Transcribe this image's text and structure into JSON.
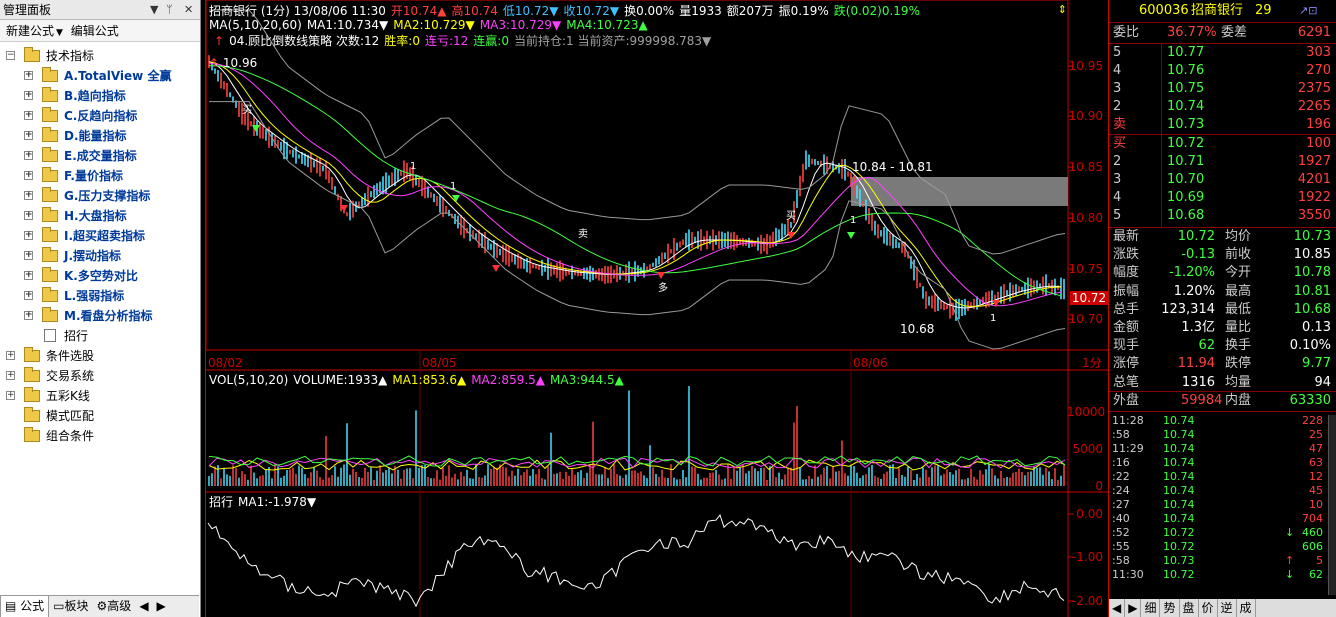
{
  "left_panel": {
    "title": "管理面板",
    "toolbar": {
      "new_formula": "新建公式",
      "edit_formula": "编辑公式"
    },
    "tree": [
      {
        "label": "技术指标",
        "level": 0,
        "type": "folder",
        "expander": "-"
      },
      {
        "label": "A.TotalView 全赢",
        "level": 1,
        "type": "folder",
        "expander": "+"
      },
      {
        "label": "B.趋向指标",
        "level": 1,
        "type": "folder",
        "expander": "+"
      },
      {
        "label": "C.反趋向指标",
        "level": 1,
        "type": "folder",
        "expander": "+"
      },
      {
        "label": "D.能量指标",
        "level": 1,
        "type": "folder",
        "expander": "+"
      },
      {
        "label": "E.成交量指标",
        "level": 1,
        "type": "folder",
        "expander": "+"
      },
      {
        "label": "F.量价指标",
        "level": 1,
        "type": "folder",
        "expander": "+"
      },
      {
        "label": "G.压力支撑指标",
        "level": 1,
        "type": "folder",
        "expander": "+"
      },
      {
        "label": "H.大盘指标",
        "level": 1,
        "type": "folder",
        "expander": "+"
      },
      {
        "label": "I.超买超卖指标",
        "level": 1,
        "type": "folder",
        "expander": "+"
      },
      {
        "label": "J.摆动指标",
        "level": 1,
        "type": "folder",
        "expander": "+"
      },
      {
        "label": "K.多空势对比",
        "level": 1,
        "type": "folder",
        "expander": "+"
      },
      {
        "label": "L.强弱指标",
        "level": 1,
        "type": "folder",
        "expander": "+"
      },
      {
        "label": "M.看盘分析指标",
        "level": 1,
        "type": "folder",
        "expander": "+"
      },
      {
        "label": "招行",
        "level": 1,
        "type": "doc",
        "expander": ""
      },
      {
        "label": "条件选股",
        "level": 0,
        "type": "folder",
        "expander": "+"
      },
      {
        "label": "交易系统",
        "level": 0,
        "type": "folder",
        "expander": "+"
      },
      {
        "label": "五彩K线",
        "level": 0,
        "type": "folder",
        "expander": "+"
      },
      {
        "label": "模式匹配",
        "level": 0,
        "type": "folder",
        "expander": ""
      },
      {
        "label": "组合条件",
        "level": 0,
        "type": "folder",
        "expander": ""
      }
    ],
    "bottom_tabs": [
      "公式",
      "板块",
      "高级"
    ]
  },
  "chart": {
    "header1": [
      {
        "text": "招商银行 (1分)  13/08/06 11:30",
        "color": "#ffffff"
      },
      {
        "text": "开10.74▲",
        "color": "#ff4040"
      },
      {
        "text": "高10.74",
        "color": "#ff4040"
      },
      {
        "text": "低10.72▼",
        "color": "#40c0ff"
      },
      {
        "text": "收10.72▼",
        "color": "#40c0ff"
      },
      {
        "text": "换0.00%",
        "color": "#ffffff"
      },
      {
        "text": "量1933",
        "color": "#ffffff"
      },
      {
        "text": "额207万",
        "color": "#ffffff"
      },
      {
        "text": "振0.19%",
        "color": "#ffffff"
      },
      {
        "text": "跌(0.02)0.19%",
        "color": "#40ff40"
      }
    ],
    "header2": [
      {
        "text": "MA(5,10,20,60)",
        "color": "#ffffff"
      },
      {
        "text": "MA1:10.734▼",
        "color": "#ffffff"
      },
      {
        "text": "MA2:10.729▼",
        "color": "#ffff00"
      },
      {
        "text": "MA3:10.729▼",
        "color": "#ff40ff"
      },
      {
        "text": "MA4:10.723▲",
        "color": "#40ff40"
      }
    ],
    "header3": [
      {
        "text": "↑",
        "color": "#ff3030"
      },
      {
        "text": "04.顾比倒数线策略 次数:12",
        "color": "#ffffff"
      },
      {
        "text": "胜率:0",
        "color": "#ffff00"
      },
      {
        "text": "连亏:12",
        "color": "#ff40ff"
      },
      {
        "text": "连赢:0",
        "color": "#40ff40"
      },
      {
        "text": "当前持仓:1  当前资产:999998.783▼",
        "color": "#a0a0a0"
      }
    ],
    "price_axis": [
      "10.95",
      "10.90",
      "10.85",
      "10.80",
      "10.75",
      "10.70"
    ],
    "current_price_tag": "10.72",
    "annotations": {
      "high": "10.96",
      "low": "10.68",
      "zone": "10.84 - 10.81"
    },
    "date_labels": [
      "08/02",
      "08/05",
      "08/06"
    ],
    "period_label": "1分",
    "volume_header": [
      {
        "text": "VOL(5,10,20)",
        "color": "#ffffff"
      },
      {
        "text": "VOLUME:1933▲",
        "color": "#ffffff"
      },
      {
        "text": "MA1:853.6▲",
        "color": "#ffff00"
      },
      {
        "text": "MA2:859.5▲",
        "color": "#ff40ff"
      },
      {
        "text": "MA3:944.5▲",
        "color": "#40ff40"
      }
    ],
    "volume_axis": [
      "10000",
      "5000",
      "0"
    ],
    "indicator_header": [
      {
        "text": "招行",
        "color": "#ffffff"
      },
      {
        "text": "MA1:-1.978▼",
        "color": "#ffffff"
      }
    ],
    "indicator_axis": [
      "0.00",
      "-1.00",
      "-2.00"
    ],
    "signal_labels": [
      "买",
      "1",
      "1",
      "卖",
      "多"
    ]
  },
  "quote": {
    "code": "600036",
    "name": "招商银行",
    "num": "29",
    "weibi_label": "委比",
    "weibi": "36.77%",
    "weicha_label": "委差",
    "weicha": "6291",
    "asks": [
      {
        "level": "5",
        "price": "10.77",
        "vol": "303"
      },
      {
        "level": "4",
        "price": "10.76",
        "vol": "270"
      },
      {
        "level": "3",
        "price": "10.75",
        "vol": "2375"
      },
      {
        "level": "2",
        "price": "10.74",
        "vol": "2265"
      },
      {
        "level": "卖",
        "price": "10.73",
        "vol": "196"
      }
    ],
    "bids": [
      {
        "level": "买",
        "price": "10.72",
        "vol": "100"
      },
      {
        "level": "2",
        "price": "10.71",
        "vol": "1927"
      },
      {
        "level": "3",
        "price": "10.70",
        "vol": "4201"
      },
      {
        "level": "4",
        "price": "10.69",
        "vol": "1922"
      },
      {
        "level": "5",
        "price": "10.68",
        "vol": "3550"
      }
    ],
    "stats": [
      {
        "l1": "最新",
        "v1": "10.72",
        "c1": "#40ff40",
        "l2": "均价",
        "v2": "10.73",
        "c2": "#40ff40"
      },
      {
        "l1": "涨跌",
        "v1": "-0.13",
        "c1": "#40ff40",
        "l2": "前收",
        "v2": "10.85",
        "c2": "#ffffff"
      },
      {
        "l1": "幅度",
        "v1": "-1.20%",
        "c1": "#40ff40",
        "l2": "今开",
        "v2": "10.78",
        "c2": "#40ff40"
      },
      {
        "l1": "振幅",
        "v1": "1.20%",
        "c1": "#ffffff",
        "l2": "最高",
        "v2": "10.81",
        "c2": "#40ff40"
      },
      {
        "l1": "总手",
        "v1": "123,314",
        "c1": "#ffffff",
        "l2": "最低",
        "v2": "10.68",
        "c2": "#40ff40"
      },
      {
        "l1": "金额",
        "v1": "1.3亿",
        "c1": "#ffffff",
        "l2": "量比",
        "v2": "0.13",
        "c2": "#ffffff"
      },
      {
        "l1": "现手",
        "v1": "62",
        "c1": "#40ff40",
        "l2": "换手",
        "v2": "0.10%",
        "c2": "#ffffff"
      },
      {
        "l1": "涨停",
        "v1": "11.94",
        "c1": "#ff4040",
        "l2": "跌停",
        "v2": "9.77",
        "c2": "#40ff40"
      },
      {
        "l1": "总笔",
        "v1": "1316",
        "c1": "#ffffff",
        "l2": "均量",
        "v2": "94",
        "c2": "#ffffff"
      }
    ],
    "waipan_label": "外盘",
    "waipan": "59984",
    "neipan_label": "内盘",
    "neipan": "63330",
    "ticks": [
      {
        "time": "11:28",
        "price": "10.74",
        "vol": "228",
        "arrow": "",
        "vcolor": "#ff4040"
      },
      {
        "time": ":58",
        "price": "10.74",
        "vol": "25",
        "arrow": "",
        "vcolor": "#ff4040"
      },
      {
        "time": "11:29",
        "price": "10.74",
        "vol": "47",
        "arrow": "",
        "vcolor": "#ff4040"
      },
      {
        "time": ":16",
        "price": "10.74",
        "vol": "63",
        "arrow": "",
        "vcolor": "#ff4040"
      },
      {
        "time": ":22",
        "price": "10.74",
        "vol": "12",
        "arrow": "",
        "vcolor": "#ff4040"
      },
      {
        "time": ":24",
        "price": "10.74",
        "vol": "45",
        "arrow": "",
        "vcolor": "#ff4040"
      },
      {
        "time": ":27",
        "price": "10.74",
        "vol": "10",
        "arrow": "",
        "vcolor": "#ff4040"
      },
      {
        "time": ":40",
        "price": "10.74",
        "vol": "704",
        "arrow": "",
        "vcolor": "#ff4040"
      },
      {
        "time": ":52",
        "price": "10.72",
        "vol": "460",
        "arrow": "↓",
        "vcolor": "#40ff40"
      },
      {
        "time": ":55",
        "price": "10.72",
        "vol": "606",
        "arrow": "",
        "vcolor": "#40ff40"
      },
      {
        "time": ":58",
        "price": "10.73",
        "vol": "5",
        "arrow": "↑",
        "vcolor": "#ff4040"
      },
      {
        "time": "11:30",
        "price": "10.72",
        "vol": "62",
        "arrow": "↓",
        "vcolor": "#40ff40"
      }
    ],
    "bottom_tabs": [
      "细",
      "势",
      "盘",
      "价",
      "逆",
      "成"
    ]
  },
  "colors": {
    "up": "#ff4040",
    "down": "#40ff40",
    "cyan": "#40e0ff",
    "axis": "#cc0000"
  }
}
